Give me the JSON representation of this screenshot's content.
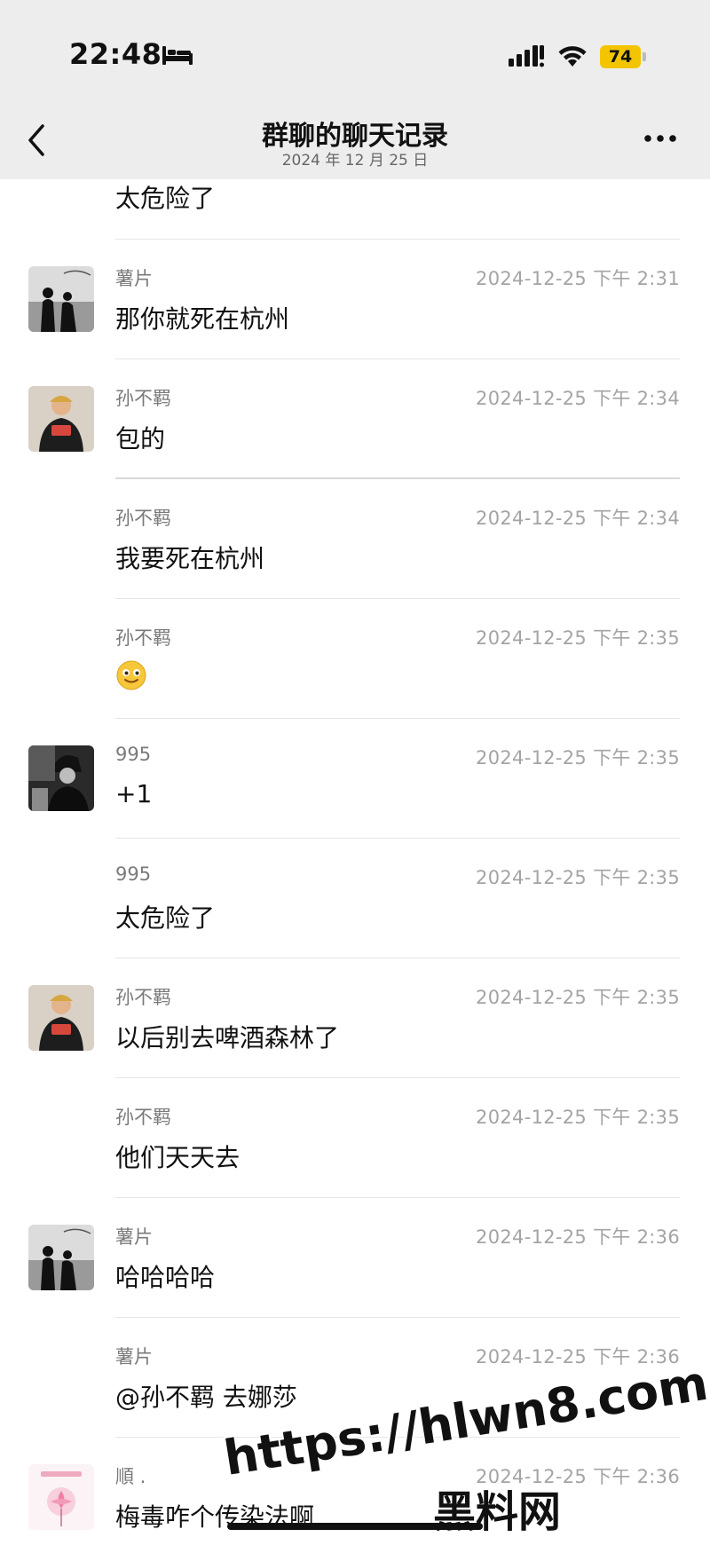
{
  "status_bar": {
    "time": "22:48",
    "battery": "74",
    "battery_color": "#f2c500"
  },
  "header": {
    "title": "群聊的聊天记录",
    "subtitle": "2024 年 12 月 25 日",
    "back_icon": "chevron-left-icon",
    "more_icon": "more-dots-icon"
  },
  "first_text": "太危险了",
  "messages": [
    {
      "avatar": "silhouette-couple",
      "sender": "薯片",
      "time": "2024-12-25 下午 2:31",
      "text": "那你就死在杭州"
    },
    {
      "avatar": "child-photo",
      "sender": "孙不羁",
      "time": "2024-12-25 下午 2:34",
      "text": "包的"
    },
    {
      "avatar": "",
      "sender": "孙不羁",
      "time": "2024-12-25 下午 2:34",
      "text": "我要死在杭州"
    },
    {
      "avatar": "",
      "sender": "孙不羁",
      "time": "2024-12-25 下午 2:35",
      "text": "",
      "emoji": "smiling-face-emoji"
    },
    {
      "avatar": "bw-portrait",
      "sender": "995",
      "time": "2024-12-25 下午 2:35",
      "text": "+1"
    },
    {
      "avatar": "",
      "sender": "995",
      "time": "2024-12-25 下午 2:35",
      "text": "太危险了"
    },
    {
      "avatar": "child-photo",
      "sender": "孙不羁",
      "time": "2024-12-25 下午 2:35",
      "text": "以后别去啤酒森林了"
    },
    {
      "avatar": "",
      "sender": "孙不羁",
      "time": "2024-12-25 下午 2:35",
      "text": "他们天天去"
    },
    {
      "avatar": "silhouette-couple",
      "sender": "薯片",
      "time": "2024-12-25 下午 2:36",
      "text": "哈哈哈哈"
    },
    {
      "avatar": "",
      "sender": "薯片",
      "time": "2024-12-25 下午 2:36",
      "text": "@孙不羁 去娜莎"
    },
    {
      "avatar": "flower-drawing",
      "sender": "順 .",
      "time": "2024-12-25 下午 2:36",
      "text": "梅毒咋个传染法啊"
    }
  ],
  "watermark": {
    "url": "https://hlwn8.com",
    "name": "黑料网"
  }
}
